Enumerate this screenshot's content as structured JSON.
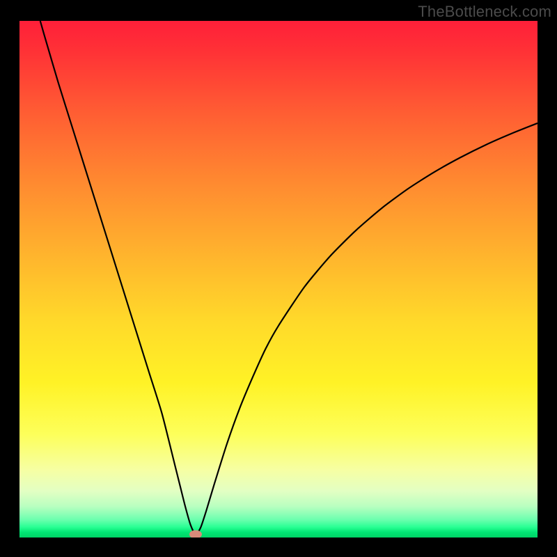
{
  "watermark": "TheBottleneck.com",
  "chart_data": {
    "type": "line",
    "title": "",
    "xlabel": "",
    "ylabel": "",
    "xlim": [
      0,
      100
    ],
    "ylim": [
      0,
      100
    ],
    "grid": false,
    "legend": false,
    "series": [
      {
        "name": "bottleneck-curve",
        "x": [
          4,
          5,
          7.5,
          10,
          12.5,
          15,
          17.5,
          20,
          22.5,
          25,
          27.5,
          30,
          31,
          32,
          33,
          34,
          35,
          36,
          37.5,
          40,
          42.5,
          45,
          47.5,
          50,
          55,
          60,
          65,
          70,
          75,
          80,
          85,
          90,
          95,
          100
        ],
        "y": [
          100,
          96.5,
          88,
          80,
          72,
          64,
          56,
          48,
          40,
          32,
          24,
          14,
          10,
          6,
          2.5,
          0.5,
          2,
          5,
          10,
          18,
          25,
          31,
          36.5,
          41,
          48.5,
          54.5,
          59.5,
          63.8,
          67.5,
          70.7,
          73.5,
          76,
          78.2,
          80.2
        ]
      }
    ],
    "annotations": [
      {
        "type": "marker",
        "shape": "ellipse",
        "x": 34,
        "y": 0.6,
        "color": "#d88a7a"
      }
    ],
    "background_gradient": {
      "orientation": "vertical",
      "stops": [
        {
          "pos": 0.0,
          "color": "#ff1f39"
        },
        {
          "pos": 0.5,
          "color": "#ffc82c"
        },
        {
          "pos": 0.8,
          "color": "#fdff5a"
        },
        {
          "pos": 0.95,
          "color": "#8fffb5"
        },
        {
          "pos": 1.0,
          "color": "#00d366"
        }
      ]
    }
  }
}
